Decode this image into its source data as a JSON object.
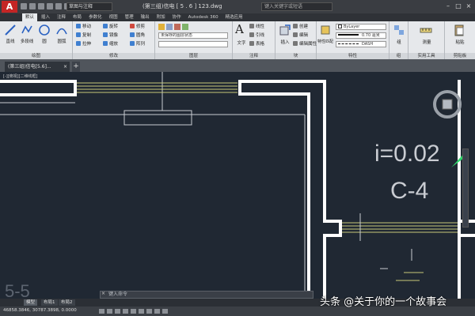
{
  "app": {
    "logo": "A",
    "workspace": "草图与注释",
    "doc_title": "(第三组)信电 [ 5 . 6 ] 123.dwg",
    "search_placeholder": "键入关键字或短语"
  },
  "ribbon_tabs": [
    "默认",
    "插入",
    "注释",
    "布局",
    "参数化",
    "视图",
    "管理",
    "输出",
    "附加",
    "协作",
    "Autodesk 360",
    "精选应用"
  ],
  "ribbon": {
    "draw": {
      "label": "绘图",
      "line": "直线",
      "polyline": "多段线",
      "circle": "圆",
      "arc": "圆弧"
    },
    "modify": {
      "label": "修改",
      "move": "移动",
      "rotate": "旋转",
      "trim": "修剪",
      "copy": "复制",
      "mirror": "镜像",
      "fillet": "圆角",
      "stretch": "拉伸",
      "scale": "缩放",
      "array": "阵列"
    },
    "layer": {
      "label": "图层",
      "state": "未保存的图层状态"
    },
    "annotation": {
      "label": "注释",
      "text": "文字",
      "dim": "标注",
      "linear": "线性",
      "leader": "引线",
      "table": "表格"
    },
    "block": {
      "label": "块",
      "insert": "插入",
      "create": "创建",
      "edit": "编辑",
      "attr": "编辑属性"
    },
    "properties": {
      "label": "特性",
      "match": "特性匹配",
      "color": "ByLayer",
      "lineweight": "0.70 毫米",
      "linetype": "DASH"
    },
    "groups": {
      "label": "组",
      "group": "组"
    },
    "utilities": {
      "label": "实用工具",
      "measure": "测量"
    },
    "clipboard": {
      "label": "剪贴板",
      "paste": "粘贴"
    }
  },
  "file_tabs": {
    "active": "(第三组)信电[5.6]...",
    "close": "×",
    "add": "+"
  },
  "viewport_label": "[-][俯视][二维线框]",
  "drawing": {
    "slope": "i=0.02",
    "pipe_code": "C-4",
    "corner_text": "5-5"
  },
  "command_line": {
    "placeholder": "键入命令",
    "close": "×"
  },
  "layout_tabs": [
    "模型",
    "布局1",
    "布局2"
  ],
  "status": {
    "coords": "46858.3846, 30787.3898, 0.0000"
  },
  "watermark": "头条 @关于你的一个故事会",
  "colors": {
    "canvas": "#202833",
    "wall": "#ffffff",
    "pipe": "#c9c97a",
    "frame": "#c8ccd2"
  }
}
